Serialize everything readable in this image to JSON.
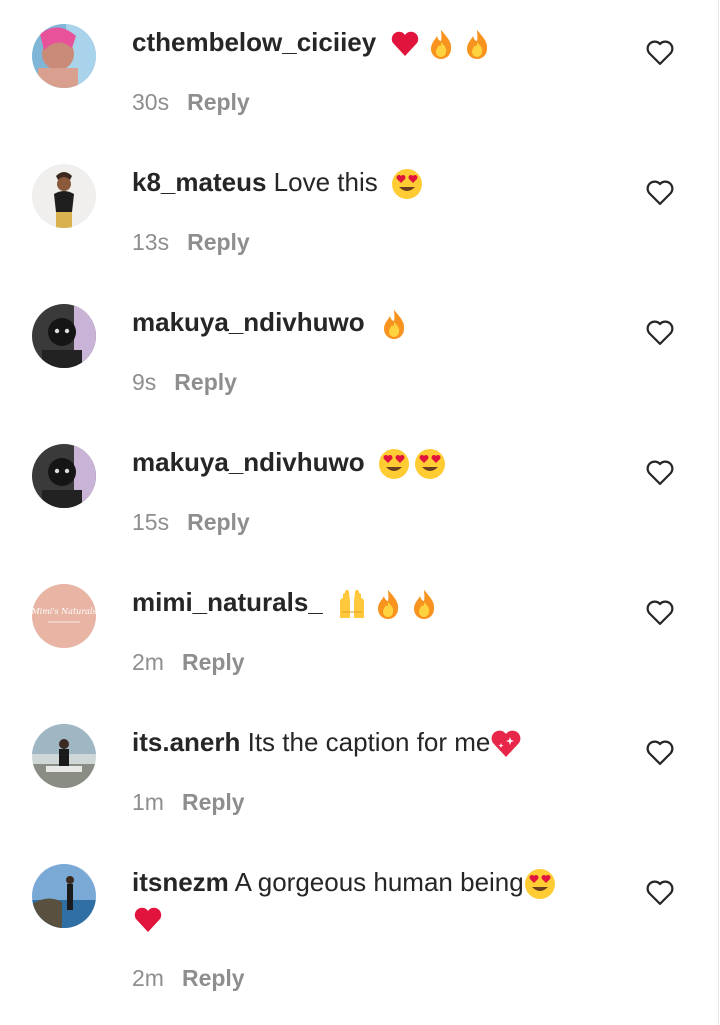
{
  "comments": [
    {
      "username": "cthembelow_ciciiey",
      "text": "",
      "emojis": [
        "red-heart",
        "fire",
        "fire"
      ],
      "time": "30s",
      "reply_label": "Reply",
      "avatar": "pink-hair"
    },
    {
      "username": "k8_mateus",
      "text": "Love this",
      "emojis": [
        "heart-eyes"
      ],
      "time": "13s",
      "reply_label": "Reply",
      "avatar": "light-figure"
    },
    {
      "username": "makuya_ndivhuwo",
      "text": "",
      "emojis": [
        "fire"
      ],
      "time": "9s",
      "reply_label": "Reply",
      "avatar": "dark-portrait"
    },
    {
      "username": "makuya_ndivhuwo",
      "text": "",
      "emojis": [
        "heart-eyes",
        "heart-eyes"
      ],
      "time": "15s",
      "reply_label": "Reply",
      "avatar": "dark-portrait"
    },
    {
      "username": "mimi_naturals_",
      "text": "",
      "emojis": [
        "raised-hands",
        "fire",
        "fire"
      ],
      "time": "2m",
      "reply_label": "Reply",
      "avatar": "peach-logo",
      "avatar_text": "Mimi's Naturals"
    },
    {
      "username": "its.anerh",
      "text": "Its the caption for me",
      "emojis": [
        "sparkling-heart"
      ],
      "time": "1m",
      "reply_label": "Reply",
      "avatar": "outdoor-photo"
    },
    {
      "username": "itsnezm",
      "text": "A gorgeous human being",
      "emojis": [
        "heart-eyes"
      ],
      "second_line_emojis": [
        "red-heart"
      ],
      "time": "2m",
      "reply_label": "Reply",
      "avatar": "beach-photo"
    }
  ],
  "icons": {
    "like": "heart-outline-icon"
  },
  "colors": {
    "text": "#262626",
    "muted": "#8e8e8e",
    "background": "#ffffff"
  }
}
